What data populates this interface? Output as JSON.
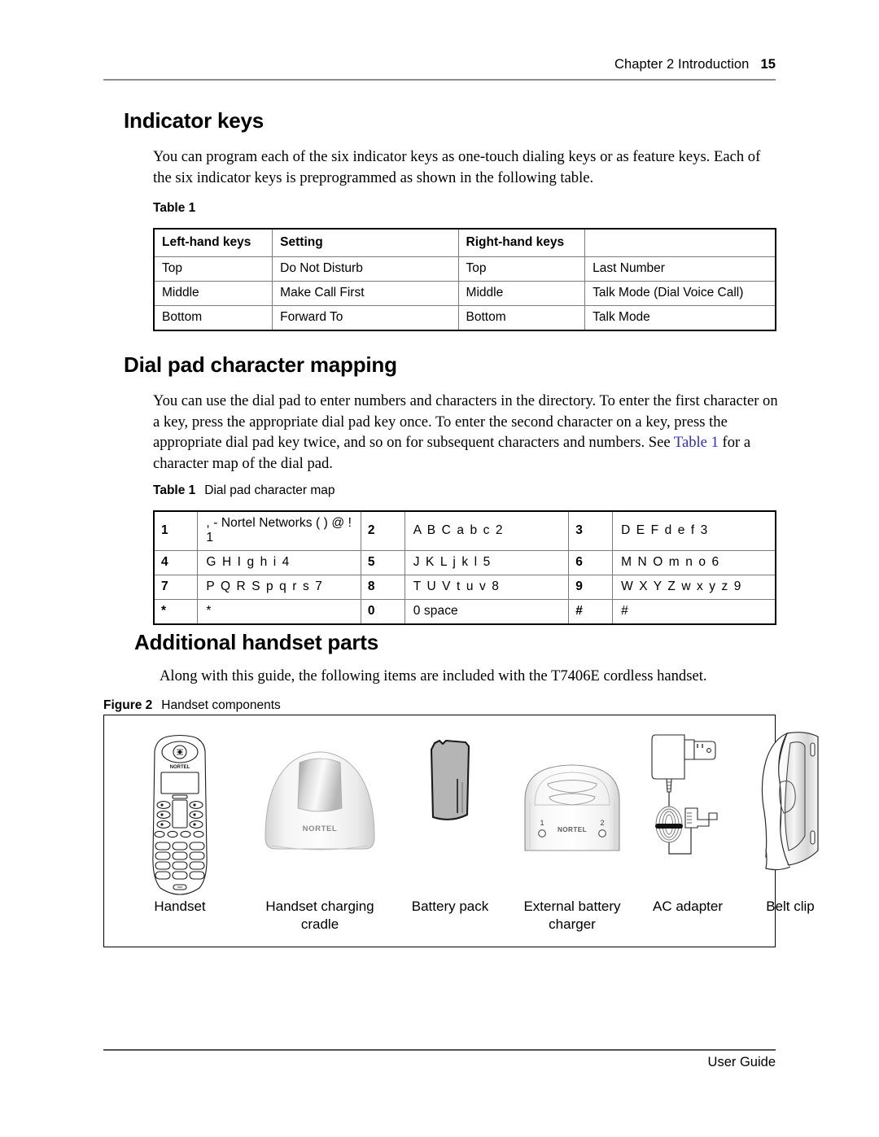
{
  "running_head": {
    "chapter": "Chapter 2  Introduction",
    "page_number": "15"
  },
  "footer": {
    "text": "User Guide"
  },
  "sections": {
    "indicator_keys": {
      "heading": "Indicator keys",
      "paragraph": "You can program each of the six indicator keys as one-touch dialing keys or as feature keys. Each of the six indicator keys is preprogrammed as shown in the following table."
    },
    "dial_pad": {
      "heading": "Dial pad character mapping",
      "paragraph_part1": "You can use the dial pad to enter numbers and characters in the directory. To enter the first character on a key, press the appropriate dial pad key once. To enter the second character on a key, press the appropriate dial pad key twice, and so on for subsequent characters and numbers. See ",
      "link_text": "Table 1",
      "link_color": "#2c2cc8",
      "paragraph_part2": " for a character map of the dial pad."
    },
    "additional_parts": {
      "heading": "Additional handset parts",
      "paragraph": "Along with this guide, the following items are included with the T7406E cordless handset."
    }
  },
  "table1": {
    "caption_number": "Table 1",
    "caption_text": "",
    "headers": [
      "Left-hand keys",
      "Setting",
      "Right-hand keys",
      ""
    ],
    "rows": [
      [
        "Top",
        "Do Not Disturb",
        "Top",
        "Last Number"
      ],
      [
        "Middle",
        "Make Call First",
        "Middle",
        "Talk Mode (Dial Voice Call)"
      ],
      [
        "Bottom",
        "Forward To",
        "Bottom",
        "Talk Mode"
      ]
    ]
  },
  "table2": {
    "caption_number": "Table 1",
    "caption_text": "Dial pad character map",
    "rows": [
      [
        {
          "key": "1",
          "chars": ", - Nortel Networks ( ) @ ! 1",
          "spaced": false
        },
        {
          "key": "2",
          "chars": "A B C a b c 2",
          "spaced": true
        },
        {
          "key": "3",
          "chars": "D E F d e f 3",
          "spaced": true
        }
      ],
      [
        {
          "key": "4",
          "chars": "G H I g h i 4",
          "spaced": true
        },
        {
          "key": "5",
          "chars": "J K L j k l 5",
          "spaced": true
        },
        {
          "key": "6",
          "chars": "M N O m n o 6",
          "spaced": true
        }
      ],
      [
        {
          "key": "7",
          "chars": "P Q R S p q r s 7",
          "spaced": true
        },
        {
          "key": "8",
          "chars": "T U V t u v 8",
          "spaced": true
        },
        {
          "key": "9",
          "chars": "W X Y Z w x y z 9",
          "spaced": true
        }
      ],
      [
        {
          "key": "*",
          "chars": "*",
          "spaced": false
        },
        {
          "key": "0",
          "chars": "0 space",
          "spaced": false
        },
        {
          "key": "#",
          "chars": "#",
          "spaced": false
        }
      ]
    ]
  },
  "figure2": {
    "caption_number": "Figure 2",
    "caption_text": "Handset components",
    "components": [
      {
        "id": "handset",
        "label": "Handset",
        "brand": "NORTEL"
      },
      {
        "id": "charging-cradle",
        "label": "Handset charging\ncradle",
        "brand": "NORTEL"
      },
      {
        "id": "battery-pack",
        "label": "Battery pack",
        "fill": "#b5b5b5"
      },
      {
        "id": "external-battery-charger",
        "label": "External battery\ncharger",
        "brand": "NORTEL",
        "led_1": "1",
        "led_2": "2"
      },
      {
        "id": "ac-adapter",
        "label": "AC adapter"
      },
      {
        "id": "belt-clip",
        "label": "Belt clip"
      }
    ]
  }
}
